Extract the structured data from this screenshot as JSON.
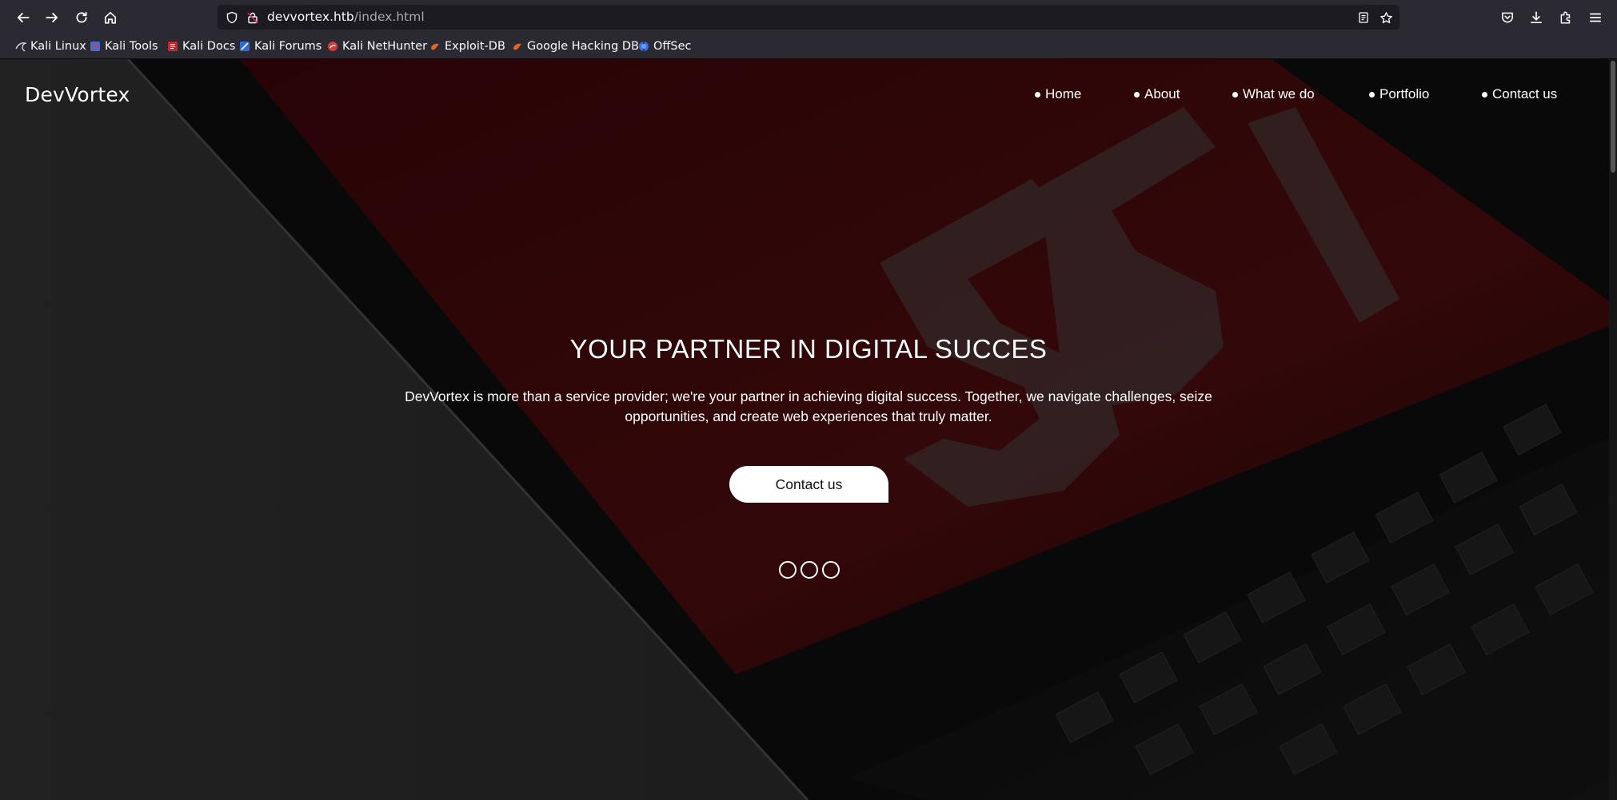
{
  "browser": {
    "url": {
      "domain": "devvortex.htb",
      "path": "/index.html"
    },
    "bookmarks": [
      {
        "label": "Kali Linux",
        "icon": "kali-linux-icon"
      },
      {
        "label": "Kali Tools",
        "icon": "kali-tools-icon"
      },
      {
        "label": "Kali Docs",
        "icon": "kali-docs-icon"
      },
      {
        "label": "Kali Forums",
        "icon": "kali-forums-icon"
      },
      {
        "label": "Kali NetHunter",
        "icon": "kali-nethunter-icon"
      },
      {
        "label": "Exploit-DB",
        "icon": "exploit-db-icon"
      },
      {
        "label": "Google Hacking DB",
        "icon": "google-hacking-db-icon"
      },
      {
        "label": "OffSec",
        "icon": "offsec-icon"
      }
    ]
  },
  "site": {
    "brand": "DevVortex",
    "nav": [
      {
        "label": "Home"
      },
      {
        "label": "About"
      },
      {
        "label": "What we do"
      },
      {
        "label": "Portfolio"
      },
      {
        "label": "Contact us"
      }
    ],
    "hero": {
      "title": "YOUR PARTNER IN DIGITAL SUCCES",
      "text": "DevVortex is more than a service provider; we're your partner in achieving digital success. Together, we navigate challenges, seize opportunities, and create web experiences that truly matter.",
      "cta_label": "Contact us"
    },
    "carousel": {
      "slides": 3
    }
  },
  "colors": {
    "chrome": "#2b2a33",
    "urlbar": "#1c1b22",
    "hero_red": "#3a0a0c",
    "text": "#ffffff"
  }
}
